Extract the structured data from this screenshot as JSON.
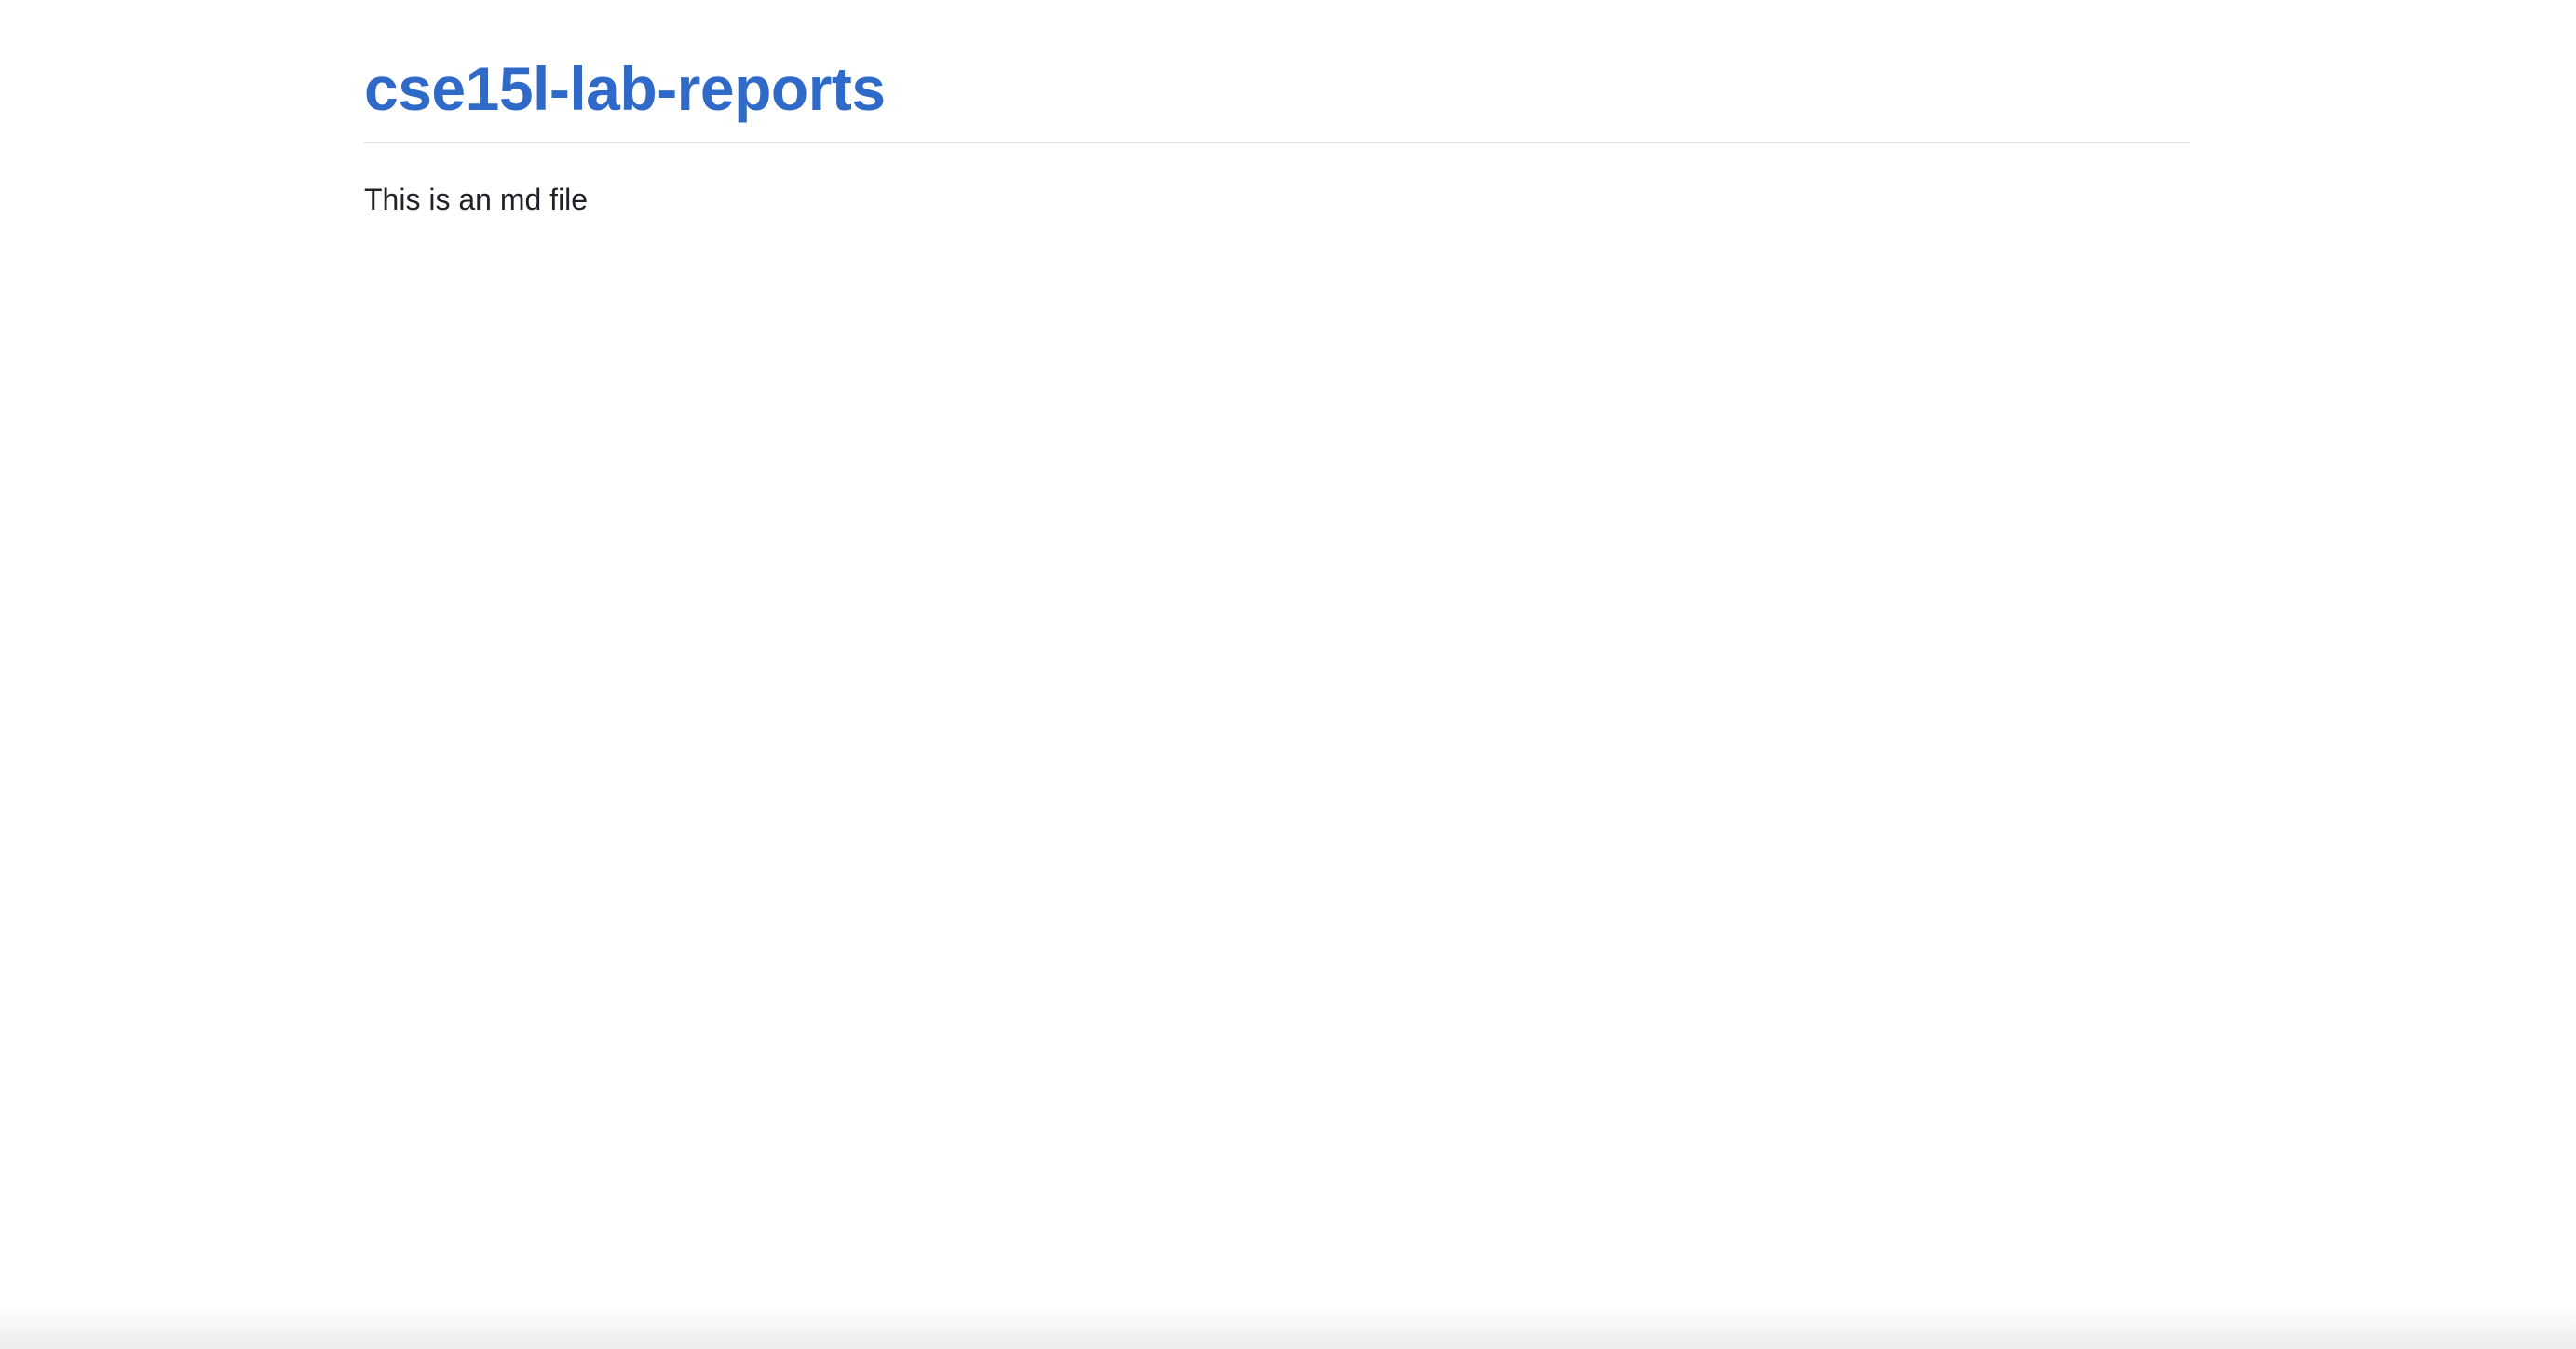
{
  "header": {
    "title": "cse15l-lab-reports"
  },
  "main": {
    "paragraph": "This is an md file"
  },
  "colors": {
    "title_link": "#2f6ac8",
    "divider": "#e5e7ea",
    "body_text": "#1f2328",
    "background": "#ffffff"
  }
}
